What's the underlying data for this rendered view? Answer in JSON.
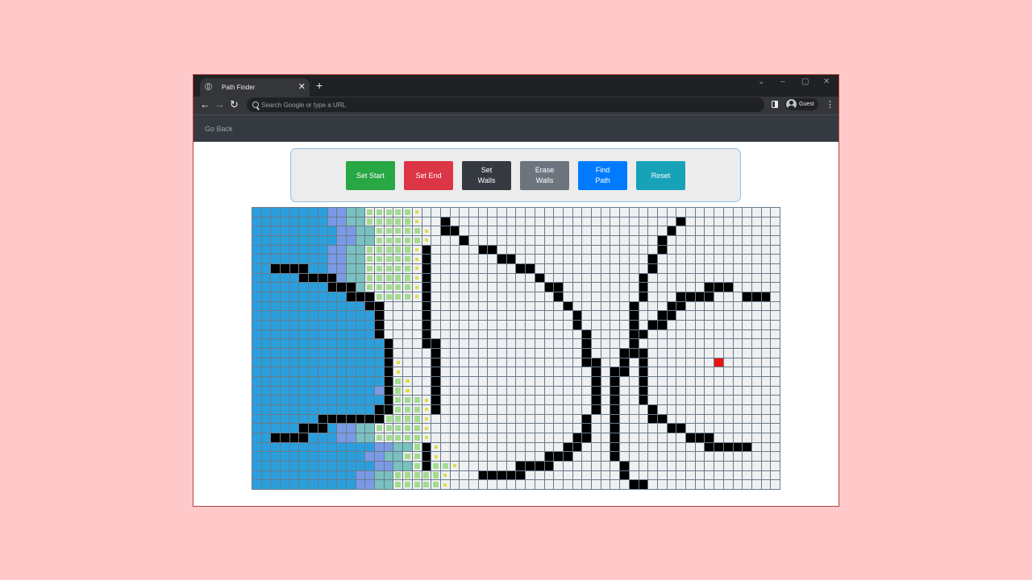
{
  "browser": {
    "tab_title": "Path Finder",
    "tab_close": "✕",
    "new_tab": "+",
    "controls": {
      "dropdown": "⌄",
      "minimize": "–",
      "maximize": "▢",
      "close": "✕"
    },
    "back": "←",
    "forward": "→",
    "reload": "↻",
    "omnibox_placeholder": "Search Google or type a URL",
    "profile_label": "Guest",
    "menu": "⋮"
  },
  "app_nav": {
    "go_back": "Go Back"
  },
  "toolbar": {
    "buttons": [
      {
        "label": "Set Start",
        "color": "#28a745"
      },
      {
        "label": "Set End",
        "color": "#dc3545"
      },
      {
        "label": "Set Walls",
        "color": "#343a40"
      },
      {
        "label": "Erase Walls",
        "color": "#6c757d"
      },
      {
        "label": "Find Path",
        "color": "#007bff"
      },
      {
        "label": "Reset",
        "color": "#17a2b8"
      }
    ]
  },
  "grid": {
    "rows": 30,
    "cols": 56,
    "state_colors": {
      "visited_old": "#2a9fdd",
      "visited": "#7a9ae6",
      "frontier_3": "#79c1bf",
      "frontier_2": "#a3dc8f",
      "frontier_1": "#dede45",
      "wall": "#000000",
      "end": "#ee1111",
      "empty": "#eef0f2"
    },
    "end_cell": [
      16,
      49
    ],
    "walls": [
      [
        1,
        20
      ],
      [
        1,
        45
      ],
      [
        2,
        20
      ],
      [
        2,
        21
      ],
      [
        2,
        44
      ],
      [
        3,
        22
      ],
      [
        3,
        43
      ],
      [
        4,
        24
      ],
      [
        4,
        25
      ],
      [
        4,
        18
      ],
      [
        4,
        43
      ],
      [
        5,
        26
      ],
      [
        5,
        27
      ],
      [
        5,
        18
      ],
      [
        5,
        42
      ],
      [
        6,
        2
      ],
      [
        6,
        3
      ],
      [
        6,
        4
      ],
      [
        6,
        5
      ],
      [
        6,
        28
      ],
      [
        6,
        29
      ],
      [
        6,
        18
      ],
      [
        6,
        42
      ],
      [
        7,
        5
      ],
      [
        7,
        6
      ],
      [
        7,
        7
      ],
      [
        7,
        8
      ],
      [
        7,
        30
      ],
      [
        7,
        18
      ],
      [
        7,
        41
      ],
      [
        8,
        8
      ],
      [
        8,
        9
      ],
      [
        8,
        10
      ],
      [
        8,
        31
      ],
      [
        8,
        32
      ],
      [
        8,
        18
      ],
      [
        8,
        41
      ],
      [
        8,
        48
      ],
      [
        8,
        49
      ],
      [
        8,
        50
      ],
      [
        9,
        10
      ],
      [
        9,
        11
      ],
      [
        9,
        12
      ],
      [
        9,
        32
      ],
      [
        9,
        18
      ],
      [
        9,
        41
      ],
      [
        9,
        45
      ],
      [
        9,
        46
      ],
      [
        9,
        47
      ],
      [
        9,
        48
      ],
      [
        9,
        52
      ],
      [
        9,
        53
      ],
      [
        9,
        54
      ],
      [
        10,
        12
      ],
      [
        10,
        13
      ],
      [
        10,
        33
      ],
      [
        10,
        18
      ],
      [
        10,
        40
      ],
      [
        10,
        44
      ],
      [
        10,
        45
      ],
      [
        11,
        13
      ],
      [
        11,
        34
      ],
      [
        11,
        18
      ],
      [
        11,
        40
      ],
      [
        11,
        43
      ],
      [
        11,
        44
      ],
      [
        12,
        13
      ],
      [
        12,
        34
      ],
      [
        12,
        18
      ],
      [
        12,
        40
      ],
      [
        12,
        42
      ],
      [
        12,
        43
      ],
      [
        13,
        13
      ],
      [
        13,
        35
      ],
      [
        13,
        18
      ],
      [
        13,
        40
      ],
      [
        13,
        41
      ],
      [
        14,
        14
      ],
      [
        14,
        35
      ],
      [
        14,
        18
      ],
      [
        14,
        19
      ],
      [
        14,
        40
      ],
      [
        15,
        14
      ],
      [
        15,
        35
      ],
      [
        15,
        19
      ],
      [
        15,
        39
      ],
      [
        15,
        40
      ],
      [
        15,
        41
      ],
      [
        16,
        14
      ],
      [
        16,
        35
      ],
      [
        16,
        36
      ],
      [
        16,
        19
      ],
      [
        16,
        39
      ],
      [
        16,
        41
      ],
      [
        17,
        14
      ],
      [
        17,
        36
      ],
      [
        17,
        19
      ],
      [
        17,
        38
      ],
      [
        17,
        39
      ],
      [
        17,
        41
      ],
      [
        18,
        14
      ],
      [
        18,
        36
      ],
      [
        18,
        19
      ],
      [
        18,
        38
      ],
      [
        18,
        41
      ],
      [
        19,
        14
      ],
      [
        19,
        36
      ],
      [
        19,
        19
      ],
      [
        19,
        38
      ],
      [
        19,
        41
      ],
      [
        20,
        14
      ],
      [
        20,
        36
      ],
      [
        20,
        19
      ],
      [
        20,
        38
      ],
      [
        20,
        41
      ],
      [
        21,
        13
      ],
      [
        21,
        14
      ],
      [
        21,
        36
      ],
      [
        21,
        19
      ],
      [
        21,
        38
      ],
      [
        21,
        42
      ],
      [
        22,
        7
      ],
      [
        22,
        8
      ],
      [
        22,
        9
      ],
      [
        22,
        10
      ],
      [
        22,
        11
      ],
      [
        22,
        12
      ],
      [
        22,
        13
      ],
      [
        22,
        35
      ],
      [
        22,
        38
      ],
      [
        22,
        42
      ],
      [
        22,
        43
      ],
      [
        23,
        5
      ],
      [
        23,
        6
      ],
      [
        23,
        7
      ],
      [
        23,
        35
      ],
      [
        23,
        38
      ],
      [
        23,
        44
      ],
      [
        23,
        45
      ],
      [
        24,
        2
      ],
      [
        24,
        3
      ],
      [
        24,
        4
      ],
      [
        24,
        5
      ],
      [
        24,
        34
      ],
      [
        24,
        35
      ],
      [
        24,
        38
      ],
      [
        24,
        46
      ],
      [
        24,
        47
      ],
      [
        24,
        48
      ],
      [
        25,
        18
      ],
      [
        25,
        33
      ],
      [
        25,
        34
      ],
      [
        25,
        38
      ],
      [
        25,
        48
      ],
      [
        25,
        49
      ],
      [
        25,
        50
      ],
      [
        25,
        51
      ],
      [
        25,
        52
      ],
      [
        26,
        18
      ],
      [
        26,
        31
      ],
      [
        26,
        32
      ],
      [
        26,
        33
      ],
      [
        26,
        38
      ],
      [
        27,
        18
      ],
      [
        27,
        28
      ],
      [
        27,
        29
      ],
      [
        27,
        30
      ],
      [
        27,
        31
      ],
      [
        27,
        39
      ],
      [
        28,
        24
      ],
      [
        28,
        25
      ],
      [
        28,
        26
      ],
      [
        28,
        27
      ],
      [
        28,
        28
      ],
      [
        28,
        39
      ],
      [
        29,
        40
      ],
      [
        29,
        41
      ]
    ],
    "left_wall_edge": [
      [
        0,
        0
      ],
      [
        1,
        0
      ],
      [
        2,
        0
      ],
      [
        3,
        0
      ],
      [
        4,
        0
      ],
      [
        5,
        0
      ],
      [
        6,
        0
      ],
      [
        7,
        0
      ],
      [
        8,
        0
      ],
      [
        9,
        0
      ],
      [
        10,
        13
      ],
      [
        11,
        13
      ],
      [
        12,
        13
      ],
      [
        13,
        13
      ],
      [
        14,
        14
      ],
      [
        15,
        14
      ],
      [
        16,
        14
      ],
      [
        17,
        14
      ],
      [
        18,
        14
      ],
      [
        19,
        14
      ],
      [
        20,
        14
      ],
      [
        21,
        13
      ],
      [
        22,
        0
      ],
      [
        23,
        0
      ],
      [
        24,
        0
      ],
      [
        25,
        0
      ],
      [
        26,
        0
      ],
      [
        27,
        0
      ],
      [
        28,
        0
      ],
      [
        29,
        0
      ]
    ],
    "frontier_right_extent": [
      17,
      17,
      18,
      18,
      18,
      18,
      17,
      17,
      17,
      17,
      0,
      0,
      0,
      0,
      0,
      0,
      15,
      15,
      16,
      16,
      18,
      18,
      18,
      18,
      18,
      19,
      19,
      21,
      20,
      20
    ]
  }
}
